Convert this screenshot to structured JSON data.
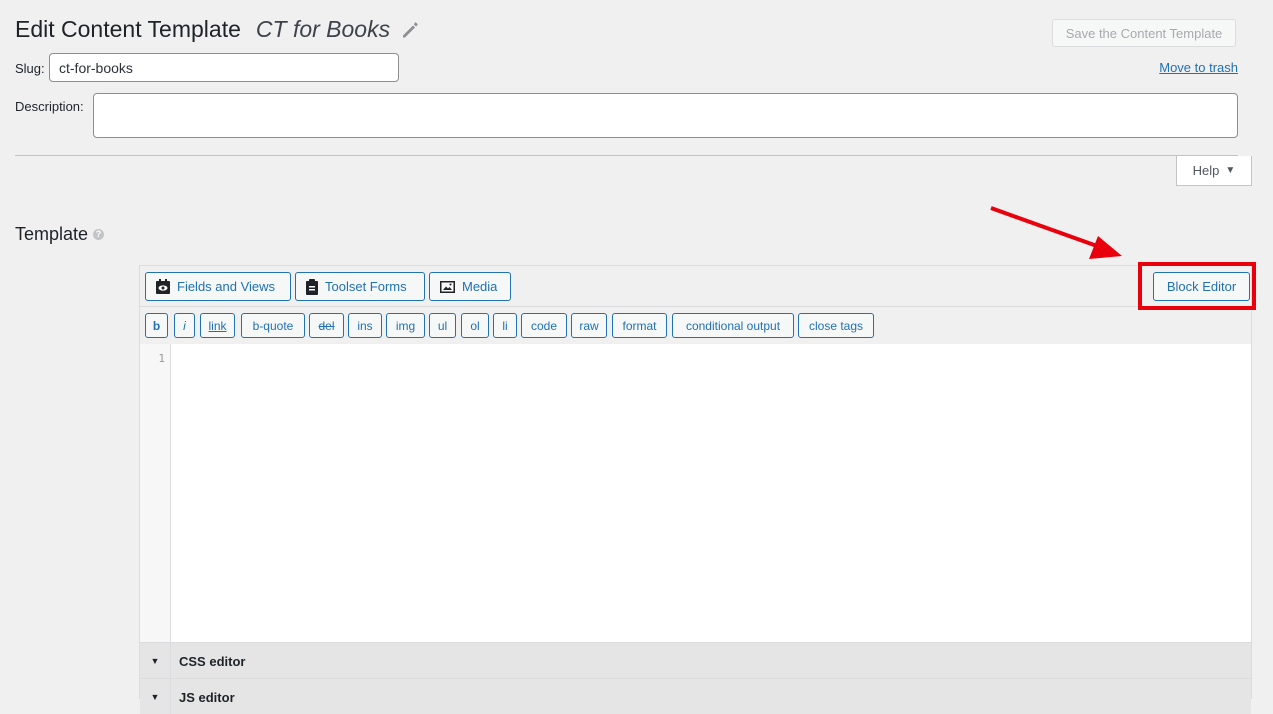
{
  "header": {
    "page_title": "Edit Content Template",
    "template_name": "CT for Books",
    "save_label": "Save the Content Template",
    "trash_label": "Move to trash"
  },
  "slug": {
    "label": "Slug:",
    "value": "ct-for-books"
  },
  "description": {
    "label": "Description:",
    "value": ""
  },
  "help": {
    "label": "Help",
    "caret": "▼"
  },
  "template": {
    "heading": "Template",
    "help_icon": "?"
  },
  "toolbar": {
    "fields_views": "Fields and Views",
    "toolset_forms": "Toolset Forms",
    "media": "Media",
    "block_editor": "Block Editor"
  },
  "quicktags": [
    "b",
    "i",
    "link",
    "b-quote",
    "del",
    "ins",
    "img",
    "ul",
    "ol",
    "li",
    "code",
    "raw",
    "format",
    "conditional output",
    "close tags"
  ],
  "code_editor": {
    "line_number": "1"
  },
  "sections": {
    "css": "CSS editor",
    "js": "JS editor"
  },
  "colors": {
    "accent": "#2271b1",
    "highlight": "#e8000c"
  }
}
